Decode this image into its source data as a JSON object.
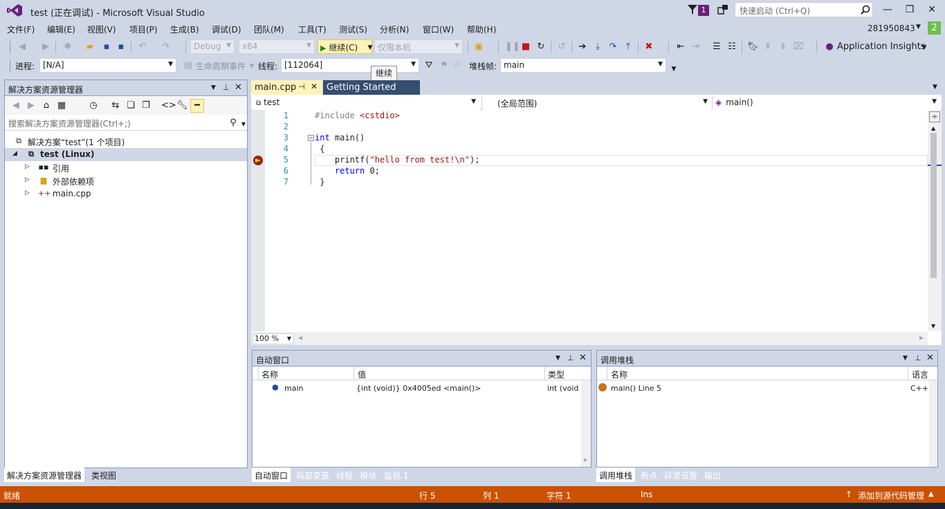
{
  "window": {
    "title": "test (正在调试) - Microsoft Visual Studio",
    "notification_count": "1",
    "quick_launch_placeholder": "快速启动 (Ctrl+Q)",
    "account": "281950843",
    "account_badge": "2"
  },
  "menu": [
    "文件(F)",
    "编辑(E)",
    "视图(V)",
    "项目(P)",
    "生成(B)",
    "调试(D)",
    "团队(M)",
    "工具(T)",
    "测试(S)",
    "分析(N)",
    "窗口(W)",
    "帮助(H)"
  ],
  "toolbar": {
    "config": "Debug",
    "platform": "x64",
    "continue_label": "继续(C)",
    "target": "仅限本机",
    "app_insights": "Application Insights",
    "tooltip": "继续"
  },
  "debug_location": {
    "process_label": "进程:",
    "process_value": "[N/A]",
    "lifecycle_label": "生命周期事件",
    "thread_label": "线程:",
    "thread_value": "[112064]",
    "stack_label": "堆栈帧:",
    "stack_value": "main"
  },
  "solution_explorer": {
    "title": "解决方案资源管理器",
    "search_placeholder": "搜索解决方案资源管理器(Ctrl+;)",
    "items": [
      {
        "label": "解决方案“test”(1 个项目)"
      },
      {
        "label": "test (Linux)"
      },
      {
        "label": "引用"
      },
      {
        "label": "外部依赖项"
      },
      {
        "label": "main.cpp"
      }
    ],
    "tabs": [
      "解决方案资源管理器",
      "类视图"
    ]
  },
  "editor": {
    "tabs": [
      "main.cpp",
      "Getting Started"
    ],
    "nav": {
      "project": "test",
      "scope": "(全局范围)",
      "member": "main()"
    },
    "zoom": "100 %",
    "lines": [
      {
        "num": "1",
        "parts": [
          {
            "t": "#include ",
            "c": "pp"
          },
          {
            "t": "<cstdio>",
            "c": "str"
          }
        ]
      },
      {
        "num": "2",
        "parts": []
      },
      {
        "num": "3",
        "parts": [
          {
            "t": "int",
            "c": "kw"
          },
          {
            "t": " main()",
            "c": ""
          }
        ]
      },
      {
        "num": "4",
        "parts": [
          {
            "t": " {",
            "c": ""
          }
        ]
      },
      {
        "num": "5",
        "parts": [
          {
            "t": "    printf(",
            "c": ""
          },
          {
            "t": "\"hello from test!\\n\"",
            "c": "str"
          },
          {
            "t": ");",
            "c": ""
          }
        ]
      },
      {
        "num": "6",
        "parts": [
          {
            "t": "    ",
            "c": ""
          },
          {
            "t": "return",
            "c": "kw"
          },
          {
            "t": " 0;",
            "c": ""
          }
        ]
      },
      {
        "num": "7",
        "parts": [
          {
            "t": " }",
            "c": ""
          }
        ]
      }
    ]
  },
  "autos": {
    "title": "自动窗口",
    "columns": [
      "名称",
      "值",
      "类型"
    ],
    "rows": [
      {
        "name": "main",
        "value": "{int (void)} 0x4005ed <main()>",
        "type": "int (void"
      }
    ],
    "tabs": [
      "自动窗口",
      "局部变量",
      "线程",
      "模块",
      "监视 1"
    ]
  },
  "callstack": {
    "title": "调用堆栈",
    "columns": [
      "名称",
      "语言"
    ],
    "rows": [
      {
        "name": "main() Line 5",
        "lang": "C++"
      }
    ],
    "tabs": [
      "调用堆栈",
      "断点",
      "异常设置",
      "输出"
    ]
  },
  "status": {
    "ready": "就绪",
    "line": "行 5",
    "col": "列 1",
    "char": "字符 1",
    "ins": "Ins",
    "source_control": "添加到源代码管理"
  },
  "colors": {
    "status_bar": "#ca5100",
    "accent": "#68217a",
    "active_tab": "#fff3b8"
  }
}
